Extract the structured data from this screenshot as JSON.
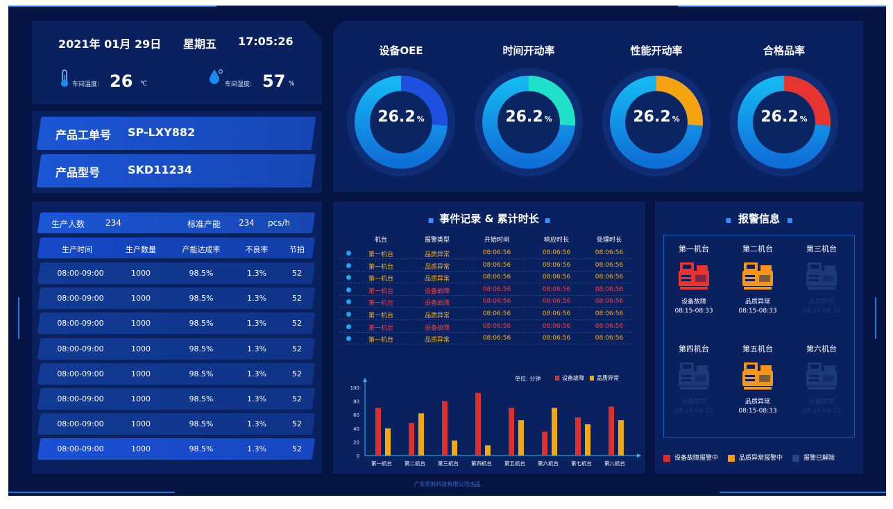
{
  "header": {
    "date": "2021年 01月 29日",
    "weekday": "星期五",
    "time": "17:05:26",
    "temp_label": "车间温度:",
    "temp_value": "26",
    "temp_unit": "℃",
    "humidity_label": "车间湿度:",
    "humidity_value": "57",
    "humidity_unit": "%"
  },
  "product": {
    "order_label": "产品工单号",
    "order_value": "SP-LXY882",
    "model_label": "产品型号",
    "model_value": "SKD11234"
  },
  "production": {
    "staff_label": "生产人数",
    "staff_value": "234",
    "std_label": "标准产能",
    "std_value": "234",
    "std_unit": "pcs/h",
    "columns": [
      "生产时间",
      "生产数量",
      "产能达成率",
      "不良率",
      "节拍"
    ],
    "rows": [
      [
        "08:00-09:00",
        "1000",
        "98.5%",
        "1.3%",
        "52"
      ],
      [
        "08:00-09:00",
        "1000",
        "98.5%",
        "1.3%",
        "52"
      ],
      [
        "08:00-09:00",
        "1000",
        "98.5%",
        "1.3%",
        "52"
      ],
      [
        "08:00-09:00",
        "1000",
        "98.5%",
        "1.3%",
        "52"
      ],
      [
        "08:00-09:00",
        "1000",
        "98.5%",
        "1.3%",
        "52"
      ],
      [
        "08:00-09:00",
        "1000",
        "98.5%",
        "1.3%",
        "52"
      ],
      [
        "08:00-09:00",
        "1000",
        "98.5%",
        "1.3%",
        "52"
      ],
      [
        "08:00-09:00",
        "1000",
        "98.5%",
        "1.3%",
        "52"
      ]
    ]
  },
  "gauges": [
    {
      "title": "设备OEE",
      "value": "26.2",
      "unit": "%",
      "fraction": 0.262,
      "color": "#1d4fe0"
    },
    {
      "title": "时间开动率",
      "value": "26.2",
      "unit": "%",
      "fraction": 0.262,
      "color": "#1fe0c8"
    },
    {
      "title": "性能开动率",
      "value": "26.2",
      "unit": "%",
      "fraction": 0.262,
      "color": "#f5a310"
    },
    {
      "title": "合格品率",
      "value": "26.2",
      "unit": "%",
      "fraction": 0.262,
      "color": "#e8342e"
    }
  ],
  "events": {
    "title": "事件记录 & 累计时长",
    "columns": [
      "机台",
      "报警类型",
      "开始时间",
      "响应时长",
      "处理时长"
    ],
    "rows": [
      {
        "machine": "第一机台",
        "type": "品质异常",
        "start": "08:06:56",
        "response": "08:06:56",
        "handle": "08:06:56",
        "level": "warn"
      },
      {
        "machine": "第一机台",
        "type": "品质异常",
        "start": "08:06:56",
        "response": "08:06:56",
        "handle": "08:06:56",
        "level": "warn"
      },
      {
        "machine": "第一机台",
        "type": "品质异常",
        "start": "08:06:56",
        "response": "08:06:56",
        "handle": "08:06:56",
        "level": "warn"
      },
      {
        "machine": "第一机台",
        "type": "设备故障",
        "start": "08:06:56",
        "response": "08:06:56",
        "handle": "08:06:56",
        "level": "fault"
      },
      {
        "machine": "第一机台",
        "type": "设备故障",
        "start": "08:06:56",
        "response": "08:06:56",
        "handle": "08:06:56",
        "level": "fault"
      },
      {
        "machine": "第一机台",
        "type": "品质异常",
        "start": "08:06:56",
        "response": "08:06:56",
        "handle": "08:06:56",
        "level": "warn"
      },
      {
        "machine": "第一机台",
        "type": "设备故障",
        "start": "08:06:56",
        "response": "08:06:56",
        "handle": "08:06:56",
        "level": "fault"
      },
      {
        "machine": "第一机台",
        "type": "品质异常",
        "start": "08:06:56",
        "response": "08:06:56",
        "handle": "08:06:56",
        "level": "warn"
      }
    ],
    "unit_label": "单位: 分钟"
  },
  "chart_data": {
    "type": "bar",
    "categories": [
      "第一机台",
      "第二机台",
      "第三机台",
      "第四机台",
      "第五机台",
      "第六机台",
      "第七机台",
      "第八机台"
    ],
    "series": [
      {
        "name": "设备故障",
        "color": "#d8322c",
        "values": [
          70,
          48,
          80,
          92,
          70,
          35,
          56,
          72
        ]
      },
      {
        "name": "品质异常",
        "color": "#f2a914",
        "values": [
          40,
          62,
          22,
          15,
          52,
          70,
          46,
          52
        ]
      }
    ],
    "ylim": [
      0,
      100
    ],
    "yticks": [
      0,
      20,
      40,
      60,
      80,
      100
    ],
    "legend": "top-right",
    "grid": false
  },
  "alarms": {
    "title": "报警信息",
    "machines": [
      {
        "name": "第一机台",
        "status": "设备故障",
        "time": "08:15-08:33",
        "state": "fault"
      },
      {
        "name": "第二机台",
        "status": "品质异常",
        "time": "08:15-08:33",
        "state": "warn"
      },
      {
        "name": "第三机台",
        "status": "品质异常",
        "time": "08:15-08:33",
        "state": "cleared"
      },
      {
        "name": "第四机台",
        "status": "设备故障",
        "time": "08:15-08:33",
        "state": "cleared"
      },
      {
        "name": "第五机台",
        "status": "品质异常",
        "time": "08:15-08:33",
        "state": "warn"
      },
      {
        "name": "第六机台",
        "status": "设备故障",
        "time": "08:15-08:33",
        "state": "cleared"
      }
    ],
    "legend": [
      {
        "label": "设备故障报警中",
        "color": "#e02b2b"
      },
      {
        "label": "品质异常报警中",
        "color": "#f59a12"
      },
      {
        "label": "报警已解除",
        "color": "#2a4680"
      }
    ]
  },
  "footer": "广东讯熊科技有限公司出品",
  "colors": {
    "background": "#061444",
    "panel": "#0a2160",
    "accent": "#1d7be8",
    "fault": "#e02b2b",
    "warn": "#f59a12"
  }
}
